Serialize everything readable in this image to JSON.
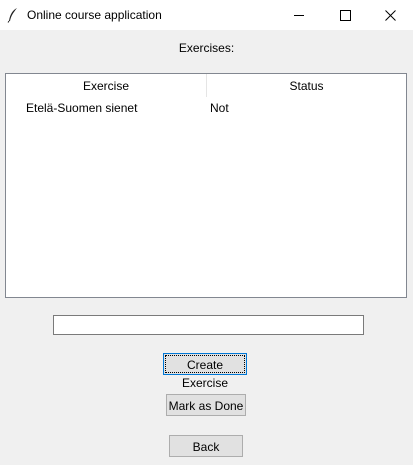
{
  "window": {
    "title": "Online course application",
    "icon": "feather-icon",
    "controls": [
      "minimize-icon",
      "maximize-icon",
      "close-icon"
    ]
  },
  "heading": "Exercises:",
  "table": {
    "columns": [
      "Exercise",
      "Status"
    ],
    "rows": [
      {
        "exercise": "Etelä-Suomen sienet",
        "status": "Not"
      }
    ]
  },
  "entry": {
    "value": "",
    "placeholder": ""
  },
  "buttons": {
    "create": "Create Exercise",
    "done": "Mark as Done",
    "back": "Back"
  }
}
